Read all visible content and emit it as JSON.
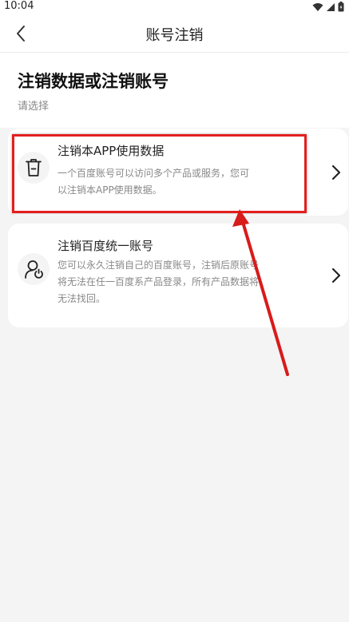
{
  "status_bar": {
    "time": "10:04"
  },
  "nav": {
    "title": "账号注销"
  },
  "header": {
    "title": "注销数据或注销账号",
    "subtitle": "请选择"
  },
  "options": [
    {
      "title": "注销本APP使用数据",
      "desc": "一个百度账号可以访问多个产品或服务，您可以注销本APP使用数据。",
      "icon": "trash-icon"
    },
    {
      "title": "注销百度统一账号",
      "desc": "您可以永久注销自己的百度账号，注销后原账号将无法在任一百度系产品登录，所有产品数据将无法找回。",
      "icon": "user-power-icon"
    }
  ],
  "colors": {
    "highlight": "#e41e1e",
    "background": "#f4f4f4"
  }
}
